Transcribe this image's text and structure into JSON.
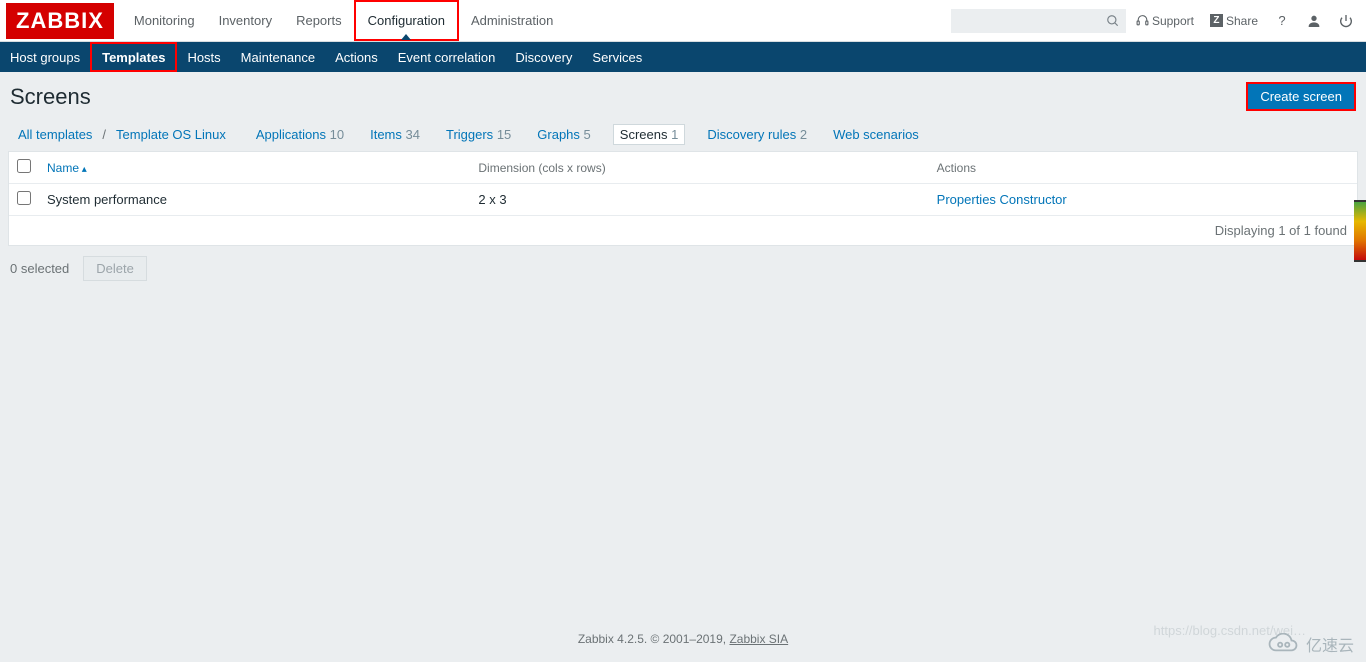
{
  "logo": "ZABBIX",
  "top_nav": {
    "items": [
      {
        "label": "Monitoring",
        "active": false,
        "highlight": false
      },
      {
        "label": "Inventory",
        "active": false,
        "highlight": false
      },
      {
        "label": "Reports",
        "active": false,
        "highlight": false
      },
      {
        "label": "Configuration",
        "active": true,
        "highlight": true
      },
      {
        "label": "Administration",
        "active": false,
        "highlight": false
      }
    ]
  },
  "top_right": {
    "support": "Support",
    "share": "Share",
    "help": "?"
  },
  "sub_nav": {
    "items": [
      {
        "label": "Host groups",
        "highlight": false
      },
      {
        "label": "Templates",
        "highlight": true
      },
      {
        "label": "Hosts",
        "highlight": false
      },
      {
        "label": "Maintenance",
        "highlight": false
      },
      {
        "label": "Actions",
        "highlight": false
      },
      {
        "label": "Event correlation",
        "highlight": false
      },
      {
        "label": "Discovery",
        "highlight": false
      },
      {
        "label": "Services",
        "highlight": false
      }
    ]
  },
  "page": {
    "title": "Screens",
    "create_button": "Create screen"
  },
  "tabs": {
    "all_templates": "All templates",
    "template_name": "Template OS Linux",
    "items": [
      {
        "label": "Applications",
        "count": "10",
        "active": false
      },
      {
        "label": "Items",
        "count": "34",
        "active": false
      },
      {
        "label": "Triggers",
        "count": "15",
        "active": false
      },
      {
        "label": "Graphs",
        "count": "5",
        "active": false
      },
      {
        "label": "Screens",
        "count": "1",
        "active": true
      },
      {
        "label": "Discovery rules",
        "count": "2",
        "active": false
      },
      {
        "label": "Web scenarios",
        "count": "",
        "active": false
      }
    ]
  },
  "table": {
    "headers": {
      "name": "Name",
      "dimension": "Dimension (cols x rows)",
      "actions": "Actions"
    },
    "rows": [
      {
        "name": "System performance",
        "dimension": "2 x 3",
        "action1": "Properties",
        "action2": "Constructor"
      }
    ],
    "footer": "Displaying 1 of 1 found"
  },
  "below": {
    "selected": "0 selected",
    "delete": "Delete"
  },
  "footer": {
    "text_prefix": "Zabbix 4.2.5. © 2001–2019, ",
    "link": "Zabbix SIA"
  },
  "watermark": {
    "text": "亿速云",
    "url": "https://blog.csdn.net/wei…"
  }
}
